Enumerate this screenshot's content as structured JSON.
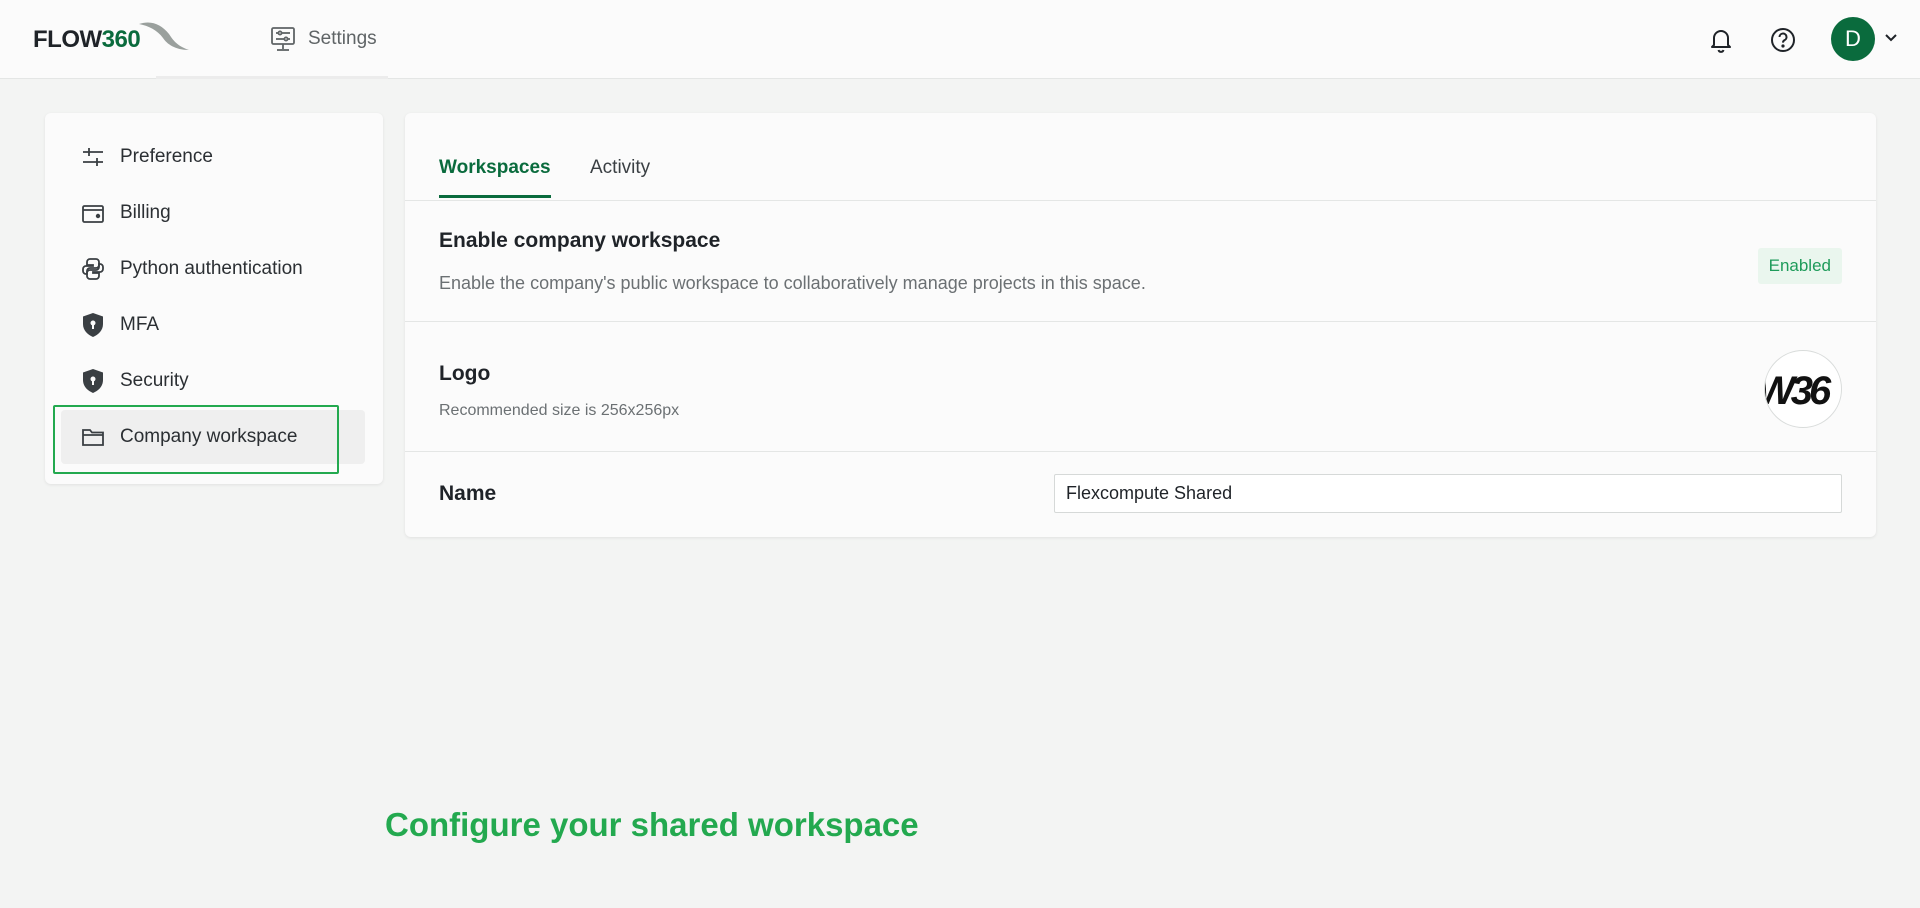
{
  "app": {
    "logo_word": "FLOW",
    "logo_num": "360",
    "nav_label": "Settings",
    "avatar_initial": "D"
  },
  "sidebar": {
    "items": [
      {
        "label": "Preference",
        "icon": "sliders-icon"
      },
      {
        "label": "Billing",
        "icon": "wallet-icon"
      },
      {
        "label": "Python authentication",
        "icon": "python-icon"
      },
      {
        "label": "MFA",
        "icon": "shield-lock-icon"
      },
      {
        "label": "Security",
        "icon": "shield-lock-icon"
      },
      {
        "label": "Company workspace",
        "icon": "folder-icon",
        "active": true
      }
    ]
  },
  "tabs": [
    {
      "label": "Workspaces",
      "active": true
    },
    {
      "label": "Activity",
      "active": false
    }
  ],
  "sections": {
    "enable": {
      "title": "Enable company workspace",
      "description": "Enable the company's public workspace to collaboratively manage projects in this space.",
      "status": "Enabled"
    },
    "logo": {
      "title": "Logo",
      "description": "Recommended size is 256x256px",
      "preview_text": "W36"
    },
    "name": {
      "title": "Name",
      "value": "Flexcompute Shared"
    }
  },
  "caption": "Configure your shared workspace",
  "colors": {
    "brand": "#0a6b3d",
    "highlight": "#23a94f",
    "enabled_text": "#1e9b5a"
  }
}
